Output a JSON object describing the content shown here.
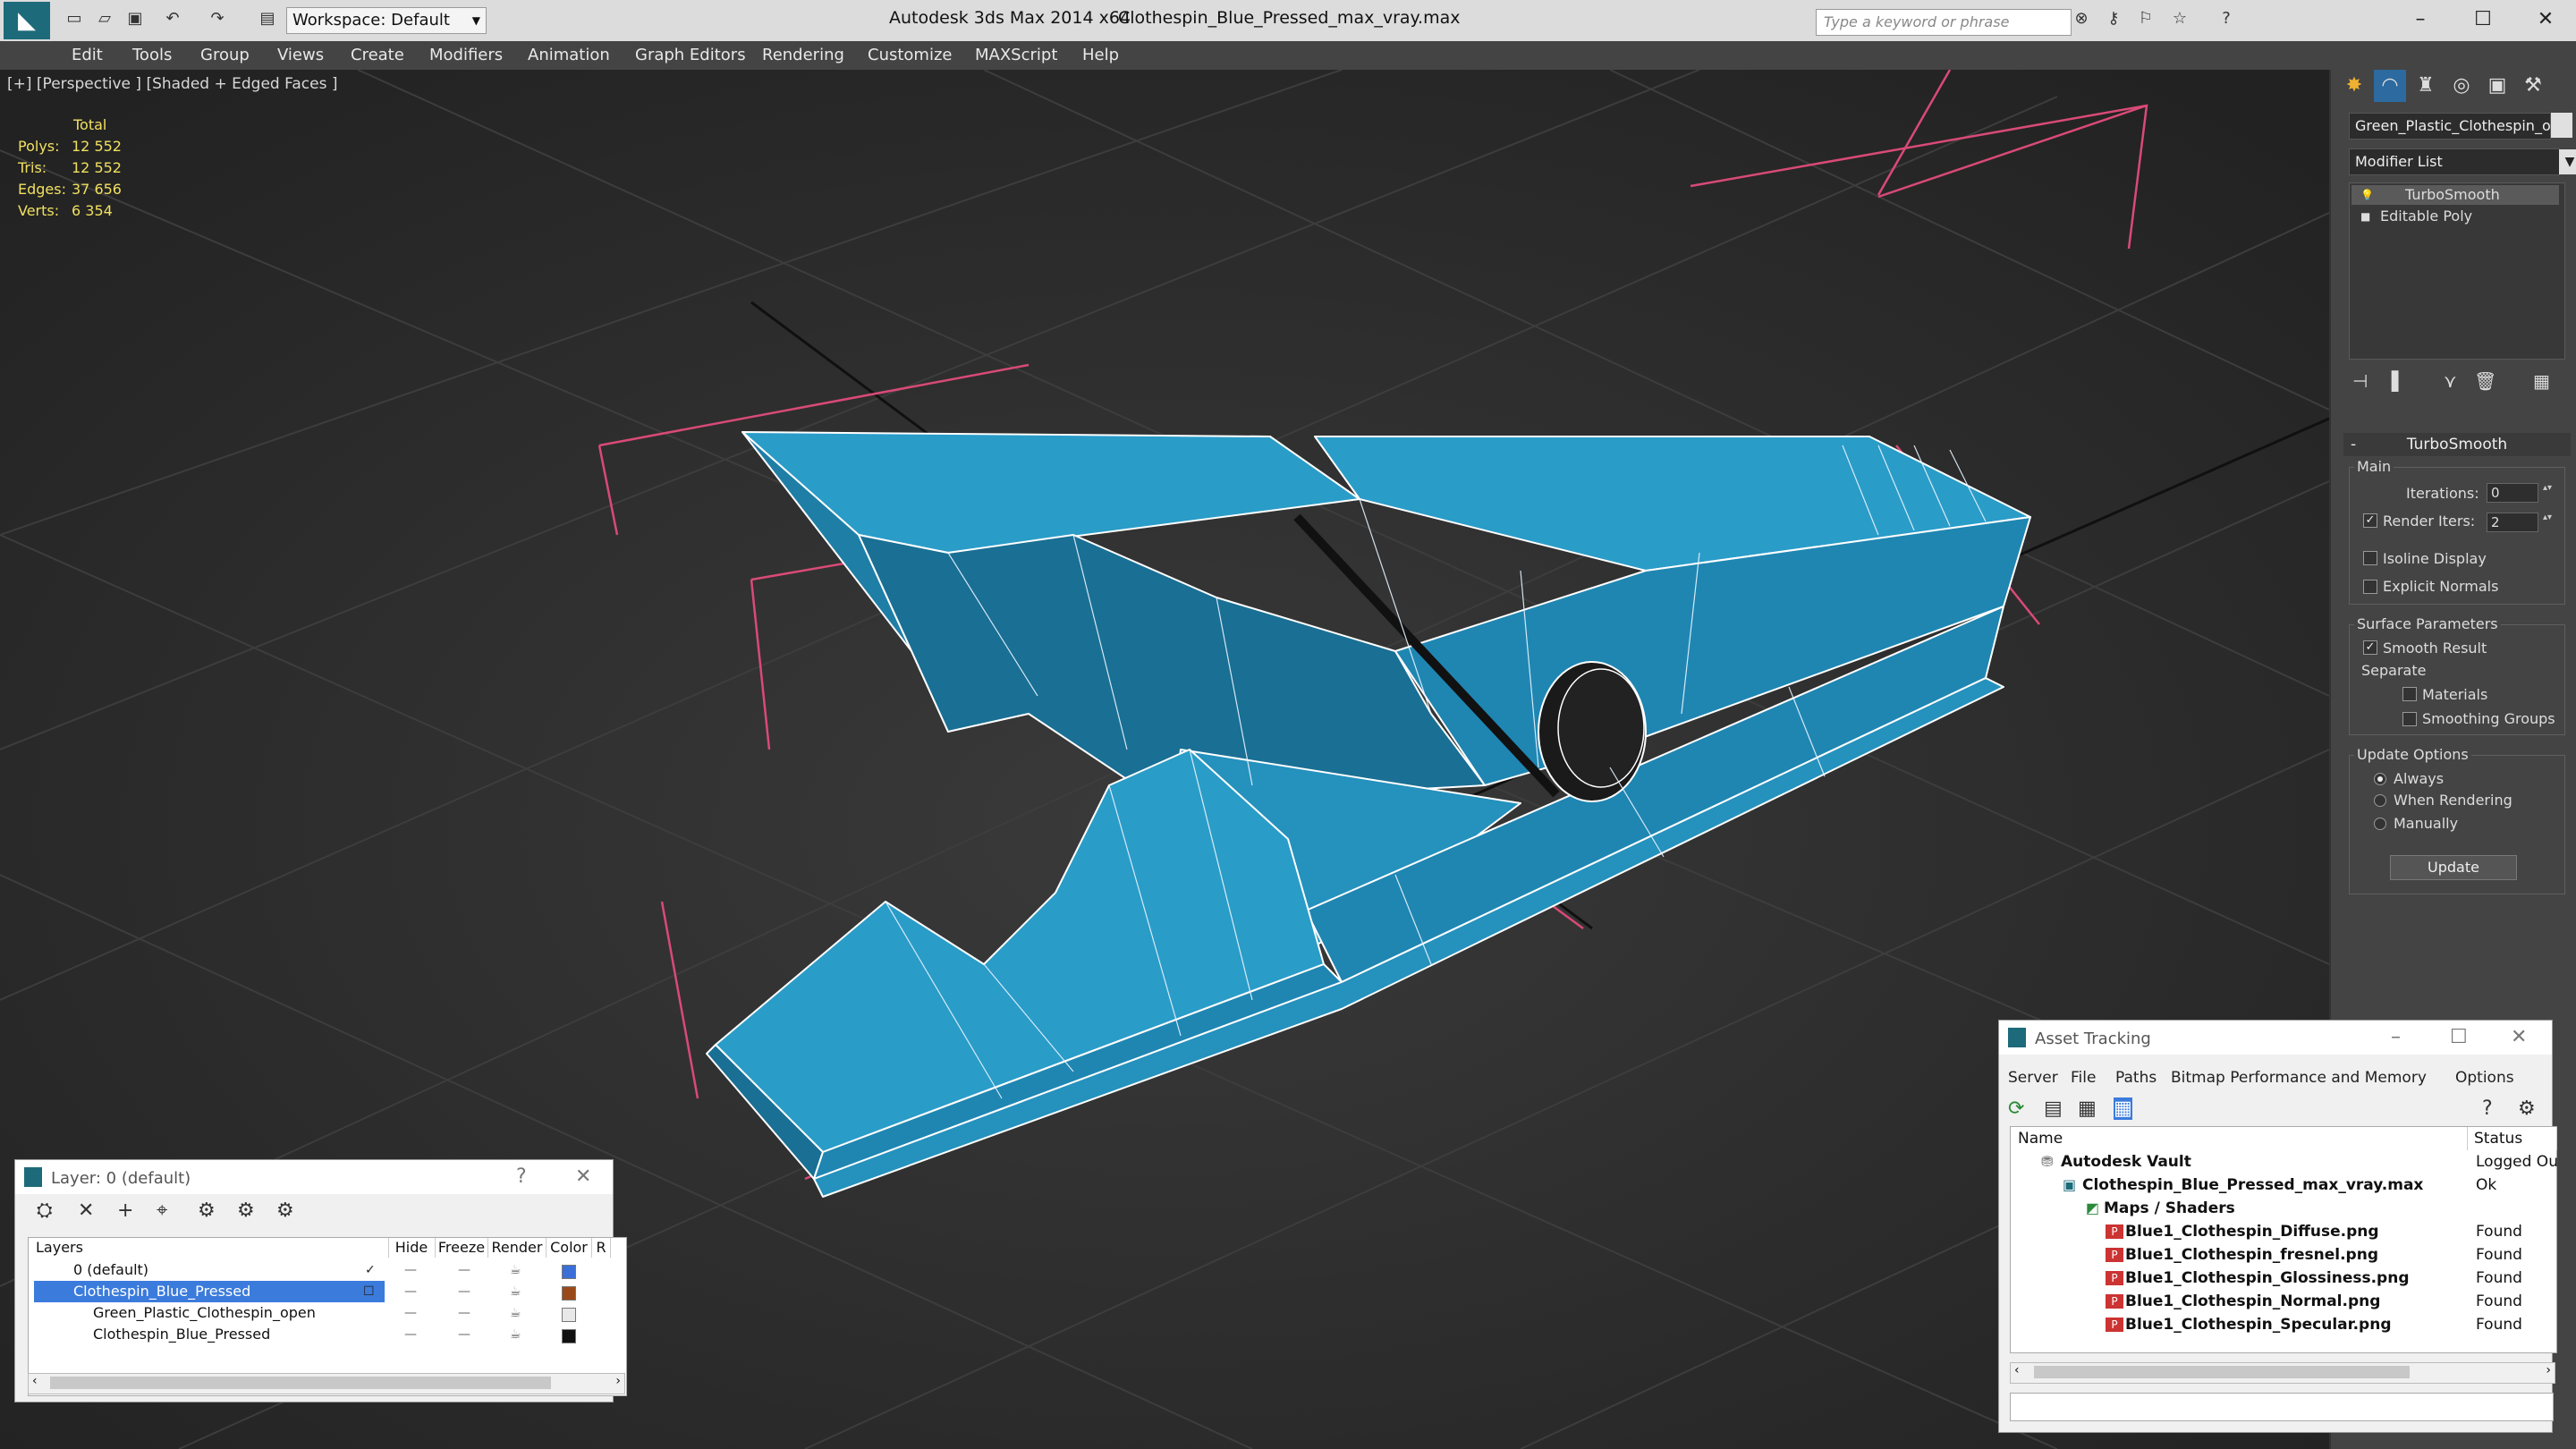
{
  "app": {
    "title": "Autodesk 3ds Max  2014 x64",
    "filename": "Clothespin_Blue_Pressed_max_vray.max",
    "workspace": "Workspace: Default",
    "search_placeholder": "Type a keyword or phrase"
  },
  "menu": [
    "Edit",
    "Tools",
    "Group",
    "Views",
    "Create",
    "Modifiers",
    "Animation",
    "Graph Editors",
    "Rendering",
    "Customize",
    "MAXScript",
    "Help"
  ],
  "viewport": {
    "label": "[+] [Perspective ] [Shaded + Edged Faces ]",
    "stats": {
      "header": "Total",
      "rows": [
        {
          "k": "Polys:",
          "v": "12 552"
        },
        {
          "k": "Tris:",
          "v": "12 552"
        },
        {
          "k": "Edges:",
          "v": "37 656"
        },
        {
          "k": "Verts:",
          "v": "6 354"
        }
      ]
    }
  },
  "command_panel": {
    "object_name": "Green_Plastic_Clothespin_open",
    "modifier_list": "Modifier List",
    "stack": [
      "TurboSmooth",
      "Editable Poly"
    ],
    "turbosmooth": {
      "title": "TurboSmooth",
      "main": "Main",
      "iterations_label": "Iterations:",
      "iterations": "0",
      "render_iters_label": "Render Iters:",
      "render_iters": "2",
      "isoline": "Isoline Display",
      "explicit_normals": "Explicit Normals",
      "surface_params": "Surface Parameters",
      "smooth_result": "Smooth Result",
      "separate": "Separate",
      "materials": "Materials",
      "smoothing_groups": "Smoothing Groups",
      "update_options": "Update Options",
      "always": "Always",
      "when_rendering": "When Rendering",
      "manually": "Manually",
      "update_button": "Update"
    }
  },
  "layer_window": {
    "title": "Layer: 0 (default)",
    "help": "?",
    "columns": [
      "Layers",
      "Hide",
      "Freeze",
      "Render",
      "Color",
      "R"
    ],
    "rows": [
      {
        "name": "0 (default)",
        "color": "#3a6fd8"
      },
      {
        "name": "Clothespin_Blue_Pressed",
        "color": "#9a4a1a"
      },
      {
        "name": "Green_Plastic_Clothespin_open",
        "color": "#e8e8e8"
      },
      {
        "name": "Clothespin_Blue_Pressed",
        "color": "#111111"
      }
    ]
  },
  "asset_tracking": {
    "title": "Asset Tracking",
    "menu": [
      "Server",
      "File",
      "Paths",
      "Bitmap Performance and Memory",
      "Options"
    ],
    "columns": [
      "Name",
      "Status"
    ],
    "rows": [
      {
        "name": "Autodesk Vault",
        "status": "Logged Ou"
      },
      {
        "name": "Clothespin_Blue_Pressed_max_vray.max",
        "status": "Ok"
      },
      {
        "name": "Maps / Shaders",
        "status": ""
      },
      {
        "name": "Blue1_Clothespin_Diffuse.png",
        "status": "Found"
      },
      {
        "name": "Blue1_Clothespin_fresnel.png",
        "status": "Found"
      },
      {
        "name": "Blue1_Clothespin_Glossiness.png",
        "status": "Found"
      },
      {
        "name": "Blue1_Clothespin_Normal.png",
        "status": "Found"
      },
      {
        "name": "Blue1_Clothespin_Specular.png",
        "status": "Found"
      }
    ]
  },
  "colors": {
    "model_blue": "#2a9cc8",
    "select_blue": "#3b7bdc",
    "stats_yellow": "#f0e060"
  }
}
